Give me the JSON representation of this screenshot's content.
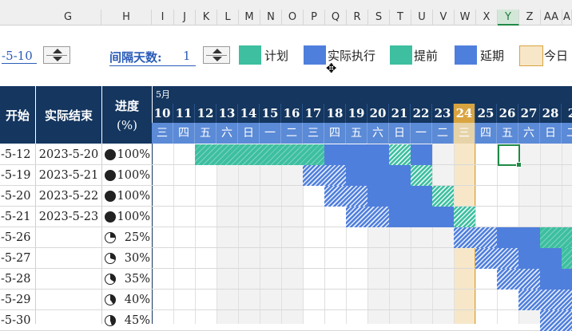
{
  "column_headers": [
    "G",
    "H",
    "I",
    "J",
    "K",
    "L",
    "M",
    "N",
    "O",
    "P",
    "Q",
    "R",
    "S",
    "T",
    "U",
    "V",
    "W",
    "X",
    "Y",
    "Z",
    "AA",
    "A"
  ],
  "controls": {
    "start_date_value": "-5-10",
    "interval_label": "间隔天数:",
    "interval_value": "1"
  },
  "legend": [
    {
      "label": "计划",
      "color": "#3dbfa0",
      "style": "solid"
    },
    {
      "label": "实际执行",
      "color": "#4f7fdc",
      "style": "solid"
    },
    {
      "label": "提前",
      "color": "#3dbfa0",
      "style": "hatch"
    },
    {
      "label": "延期",
      "color": "#4f7fdc",
      "style": "hatch"
    },
    {
      "label": "今日",
      "color": "#f7e7c8",
      "style": "solid"
    }
  ],
  "table_header": {
    "start_col": "开始",
    "actual_end_col": "实际结束",
    "progress_col": "进度",
    "progress_unit": "(%)",
    "month_label": "5月"
  },
  "days": [
    "10",
    "11",
    "12",
    "13",
    "14",
    "15",
    "16",
    "17",
    "18",
    "19",
    "20",
    "21",
    "22",
    "23",
    "24",
    "25",
    "26",
    "27",
    "28",
    "2"
  ],
  "weekdays": [
    "三",
    "四",
    "五",
    "六",
    "日",
    "一",
    "二",
    "三",
    "四",
    "五",
    "六",
    "日",
    "一",
    "二",
    "三",
    "四",
    "五",
    "六",
    "日",
    "二"
  ],
  "today_day": "24",
  "rows": [
    {
      "start": "-5-12",
      "actual_end": "2023-5-20",
      "progress": "100%"
    },
    {
      "start": "-5-19",
      "actual_end": "2023-5-21",
      "progress": "100%"
    },
    {
      "start": "-5-20",
      "actual_end": "2023-5-22",
      "progress": "100%"
    },
    {
      "start": "-5-21",
      "actual_end": "2023-5-23",
      "progress": "100%"
    },
    {
      "start": "-5-26",
      "actual_end": "",
      "progress": "25%"
    },
    {
      "start": "-5-27",
      "actual_end": "",
      "progress": "30%"
    },
    {
      "start": "-5-28",
      "actual_end": "",
      "progress": "35%"
    },
    {
      "start": "-5-29",
      "actual_end": "",
      "progress": "40%"
    },
    {
      "start": "-5-30",
      "actual_end": "",
      "progress": "45%"
    }
  ],
  "colors": {
    "header_bg": "#14365f",
    "weekday_bg": "#5b8ad7",
    "plan": "#3dbfa0",
    "actual": "#4f7fdc",
    "today": "#f7e7c8",
    "today_header": "#d9a440",
    "selection": "#1f8a45"
  }
}
